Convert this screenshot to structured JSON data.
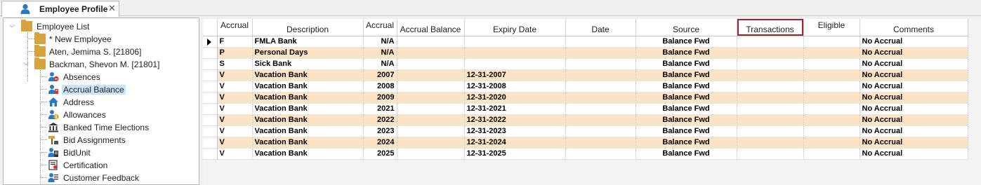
{
  "tab": {
    "label": "Employee Profile",
    "close": "✕",
    "icon": "user-icon"
  },
  "tree": {
    "root": "Employee List",
    "children": [
      {
        "label": "* New Employee"
      },
      {
        "label": "Aten, Jemima S. [21806]"
      },
      {
        "label": "Backman, Shevon M. [21801]"
      }
    ],
    "items": [
      {
        "label": "Absences",
        "icon": "absence-icon"
      },
      {
        "label": "Accrual Balance",
        "icon": "accrual-balance-icon"
      },
      {
        "label": "Address",
        "icon": "home-icon"
      },
      {
        "label": "Allowances",
        "icon": "allowances-icon"
      },
      {
        "label": "Banked Time Elections",
        "icon": "bank-icon"
      },
      {
        "label": "Bid Assignments",
        "icon": "bid-assignments-icon"
      },
      {
        "label": "BidUnit",
        "icon": "bidunit-icon"
      },
      {
        "label": "Certification",
        "icon": "certification-icon"
      },
      {
        "label": "Customer Feedback",
        "icon": "customer-feedback-icon"
      }
    ]
  },
  "grid": {
    "columns": [
      "Accrual",
      "Description",
      "Accrual",
      "Accrual Balance",
      "Expiry Date",
      "Date",
      "Source",
      "Transactions",
      "Eligible",
      "Comments"
    ],
    "rows": [
      [
        "F",
        "FMLA Bank",
        "N/A",
        "",
        "",
        "",
        "Balance Fwd",
        "",
        "",
        "No Accrual"
      ],
      [
        "P",
        "Personal Days",
        "N/A",
        "",
        "",
        "",
        "Balance Fwd",
        "",
        "",
        "No Accrual"
      ],
      [
        "S",
        "Sick Bank",
        "N/A",
        "",
        "",
        "",
        "Balance Fwd",
        "",
        "",
        "No Accrual"
      ],
      [
        "V",
        "Vacation Bank",
        "2007",
        "",
        "12-31-2007",
        "",
        "Balance Fwd",
        "",
        "",
        "No Accrual"
      ],
      [
        "V",
        "Vacation Bank",
        "2008",
        "",
        "12-31-2008",
        "",
        "Balance Fwd",
        "",
        "",
        "No Accrual"
      ],
      [
        "V",
        "Vacation Bank",
        "2009",
        "",
        "12-31-2020",
        "",
        "Balance Fwd",
        "",
        "",
        "No Accrual"
      ],
      [
        "V",
        "Vacation Bank",
        "2021",
        "",
        "12-31-2021",
        "",
        "Balance Fwd",
        "",
        "",
        "No Accrual"
      ],
      [
        "V",
        "Vacation Bank",
        "2022",
        "",
        "12-31-2022",
        "",
        "Balance Fwd",
        "",
        "",
        "No Accrual"
      ],
      [
        "V",
        "Vacation Bank",
        "2023",
        "",
        "12-31-2023",
        "",
        "Balance Fwd",
        "",
        "",
        "No Accrual"
      ],
      [
        "V",
        "Vacation Bank",
        "2024",
        "",
        "12-31-2024",
        "",
        "Balance Fwd",
        "",
        "",
        "No Accrual"
      ],
      [
        "V",
        "Vacation Bank",
        "2025",
        "",
        "12-31-2025",
        "",
        "Balance Fwd",
        "",
        "",
        "No Accrual"
      ]
    ],
    "highlighted_column": "Transactions",
    "colors": {
      "alt_row": "#fbe4c6",
      "highlight_box": "#a8202a",
      "folder": "#d9a33b"
    }
  }
}
